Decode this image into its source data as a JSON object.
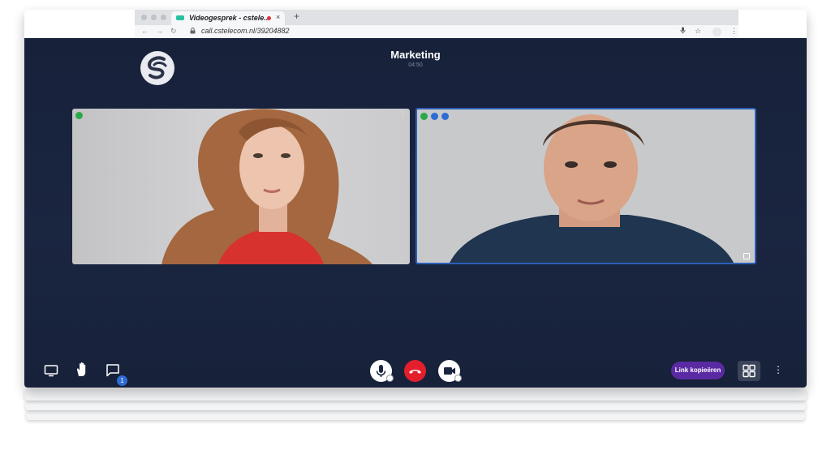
{
  "browser": {
    "tab_title": "Videogesprek - cstele..",
    "tab_close": "×",
    "new_tab": "+",
    "url": "call.cstelecom.nl/39204882",
    "back": "←",
    "forward": "→",
    "reload": "↻",
    "lock": "🔒",
    "mic": "🎙",
    "star": "☆",
    "menu": "⋮"
  },
  "call": {
    "title": "Marketing",
    "timer": "04:50"
  },
  "participants": [
    {
      "name": "",
      "signal_color": "#2aa84a"
    },
    {
      "name": "",
      "signal_color": "#2aa84a",
      "active_speaker": true,
      "border_color": "#2e5fb8"
    }
  ],
  "toolbar": {
    "share_screen": "share-screen-icon",
    "raise_hand": "hand-icon",
    "chat": "chat-icon",
    "chat_badge": "1",
    "mic": "mic-icon",
    "hangup": "hangup-icon",
    "camera": "camera-icon",
    "copy_link": "Link kopieëren",
    "layout": "grid-icon",
    "more": "⋮"
  },
  "colors": {
    "background": "#17213a",
    "hangup": "#e41f2c",
    "copy_link": "#5a2aa3",
    "accent": "#2e6bd4"
  }
}
